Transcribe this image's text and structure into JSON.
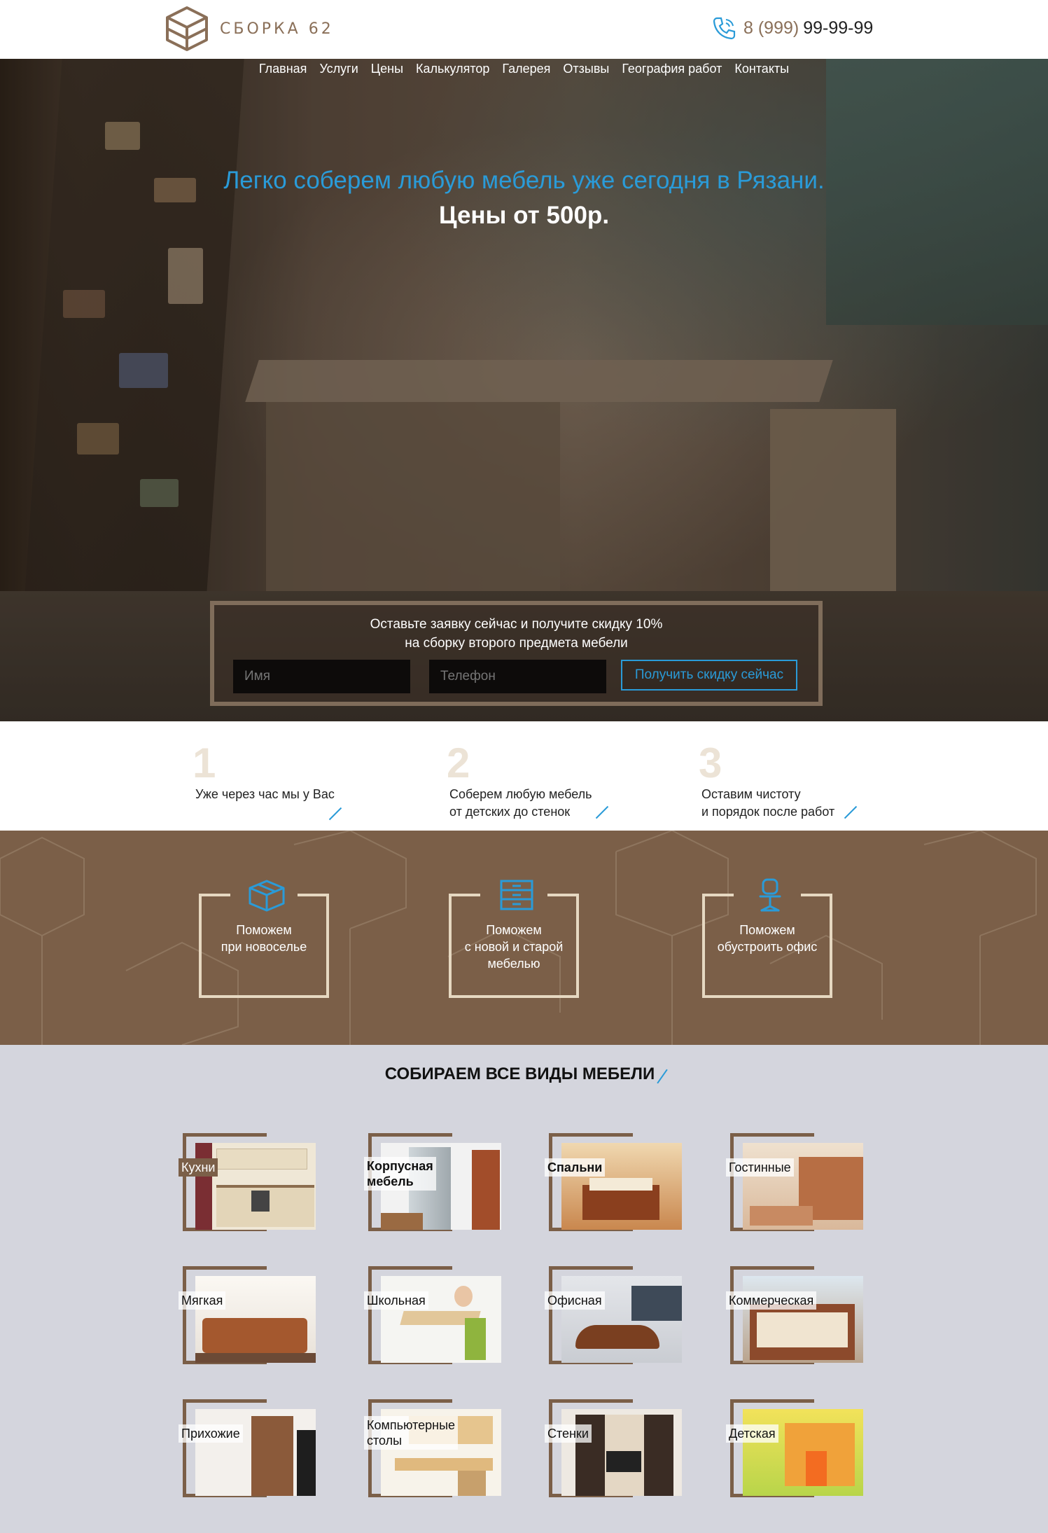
{
  "brand": {
    "name": "СБОРКА 62"
  },
  "contact": {
    "phone_code": "8 (999)",
    "phone_number": "99-99-99"
  },
  "nav": [
    "Главная",
    "Услуги",
    "Цены",
    "Калькулятор",
    "Галерея",
    "Отзывы",
    "География работ",
    "Контакты"
  ],
  "hero": {
    "title": "Легко соберем любую мебель уже сегодня в Рязани.",
    "price": "Цены от 500р."
  },
  "form": {
    "line1": "Оставьте заявку сейчас и получите скидку 10%",
    "line2": "на сборку второго предмета мебели",
    "name_placeholder": "Имя",
    "phone_placeholder": "Телефон",
    "submit_label": "Получить скидку сейчас"
  },
  "steps": [
    {
      "num": "1",
      "line1": "Уже через час мы у Вас",
      "line2": ""
    },
    {
      "num": "2",
      "line1": "Соберем любую мебель",
      "line2": "от детских до стенок"
    },
    {
      "num": "3",
      "line1": "Оставим чистоту",
      "line2": "и порядок после работ"
    }
  ],
  "help": [
    {
      "icon": "box-icon",
      "line1": "Поможем",
      "line2": "при  новоселье",
      "line3": ""
    },
    {
      "icon": "dresser-icon",
      "line1": "Поможем",
      "line2": "с новой и старой",
      "line3": "мебелью"
    },
    {
      "icon": "office-chair-icon",
      "line1": "Поможем",
      "line2": "обустроить офис",
      "line3": ""
    }
  ],
  "types": {
    "title": "СОБИРАЕМ ВСЕ ВИДЫ МЕБЕЛИ",
    "items": [
      {
        "line1": "Кухни",
        "line2": ""
      },
      {
        "line1": "Корпусная",
        "line2": "мебель"
      },
      {
        "line1": "Спальни",
        "line2": ""
      },
      {
        "line1": "Гостинные",
        "line2": ""
      },
      {
        "line1": "Мягкая",
        "line2": ""
      },
      {
        "line1": "Школьная",
        "line2": ""
      },
      {
        "line1": "Офисная",
        "line2": ""
      },
      {
        "line1": "Коммерческая",
        "line2": ""
      },
      {
        "line1": "Прихожие",
        "line2": ""
      },
      {
        "line1": "Компьютерные",
        "line2": "столы"
      },
      {
        "line1": "Стенки",
        "line2": ""
      },
      {
        "line1": "Детская",
        "line2": ""
      }
    ]
  },
  "colors": {
    "accent": "#2a9bd8",
    "brown": "#7b5f48",
    "cream": "#e6d8c1",
    "section_bg": "#d4d5dd"
  }
}
